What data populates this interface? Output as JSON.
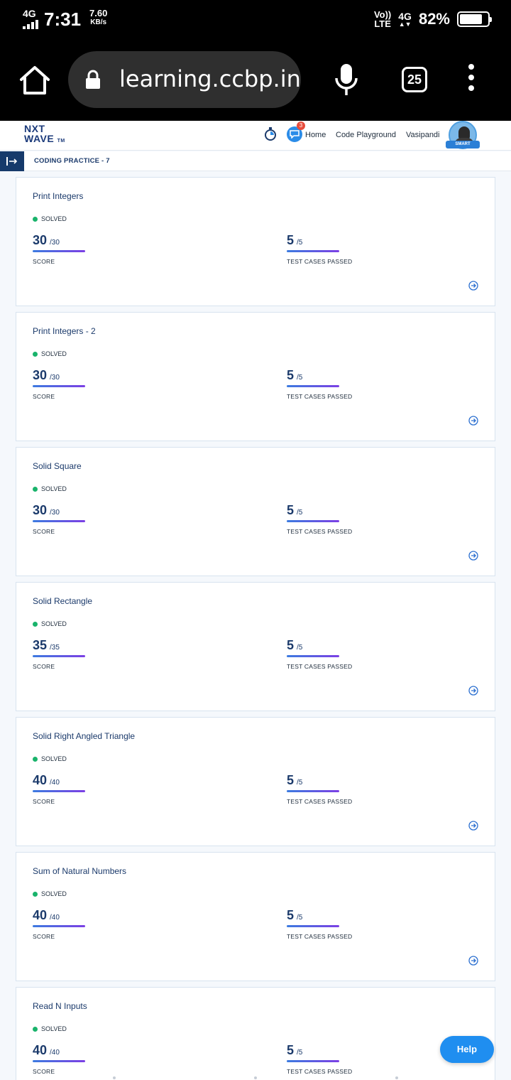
{
  "status_bar": {
    "network": "4G",
    "time": "7:31",
    "speed_value": "7.60",
    "speed_unit": "KB/s",
    "volte_top": "Vo))",
    "volte_bottom": "LTE",
    "network_right": "4G",
    "battery_percent": "82%",
    "battery_level": 0.82
  },
  "browser": {
    "url": "learning.ccbp.in/",
    "tab_count": "25",
    "icons": [
      "home-icon",
      "lock-icon",
      "mic-icon",
      "menu-icon"
    ]
  },
  "app_header": {
    "logo_line1": "NXT",
    "logo_line2": "WAVE",
    "logo_tm": "TM",
    "notification_count": "3",
    "nav": [
      "Home",
      "Code Playground",
      "Vasipandi"
    ],
    "avatar_ribbon": "SMART",
    "accent_color": "#1b3a6b"
  },
  "sub_header": {
    "title": "CODING PRACTICE - 7"
  },
  "labels": {
    "score": "SCORE",
    "tests": "TEST CASES PASSED"
  },
  "problems": [
    {
      "title": "Print Integers",
      "status": "SOLVED",
      "score": "30",
      "score_max": "/30",
      "tests": "5",
      "tests_max": "/5"
    },
    {
      "title": "Print Integers - 2",
      "status": "SOLVED",
      "score": "30",
      "score_max": "/30",
      "tests": "5",
      "tests_max": "/5"
    },
    {
      "title": "Solid Square",
      "status": "SOLVED",
      "score": "30",
      "score_max": "/30",
      "tests": "5",
      "tests_max": "/5"
    },
    {
      "title": "Solid Rectangle",
      "status": "SOLVED",
      "score": "35",
      "score_max": "/35",
      "tests": "5",
      "tests_max": "/5"
    },
    {
      "title": "Solid Right Angled Triangle",
      "status": "SOLVED",
      "score": "40",
      "score_max": "/40",
      "tests": "5",
      "tests_max": "/5"
    },
    {
      "title": "Sum of Natural Numbers",
      "status": "SOLVED",
      "score": "40",
      "score_max": "/40",
      "tests": "5",
      "tests_max": "/5"
    },
    {
      "title": "Read N Inputs",
      "status": "SOLVED",
      "score": "40",
      "score_max": "/40",
      "tests": "5",
      "tests_max": "/5"
    }
  ],
  "help": {
    "label": "Help"
  }
}
